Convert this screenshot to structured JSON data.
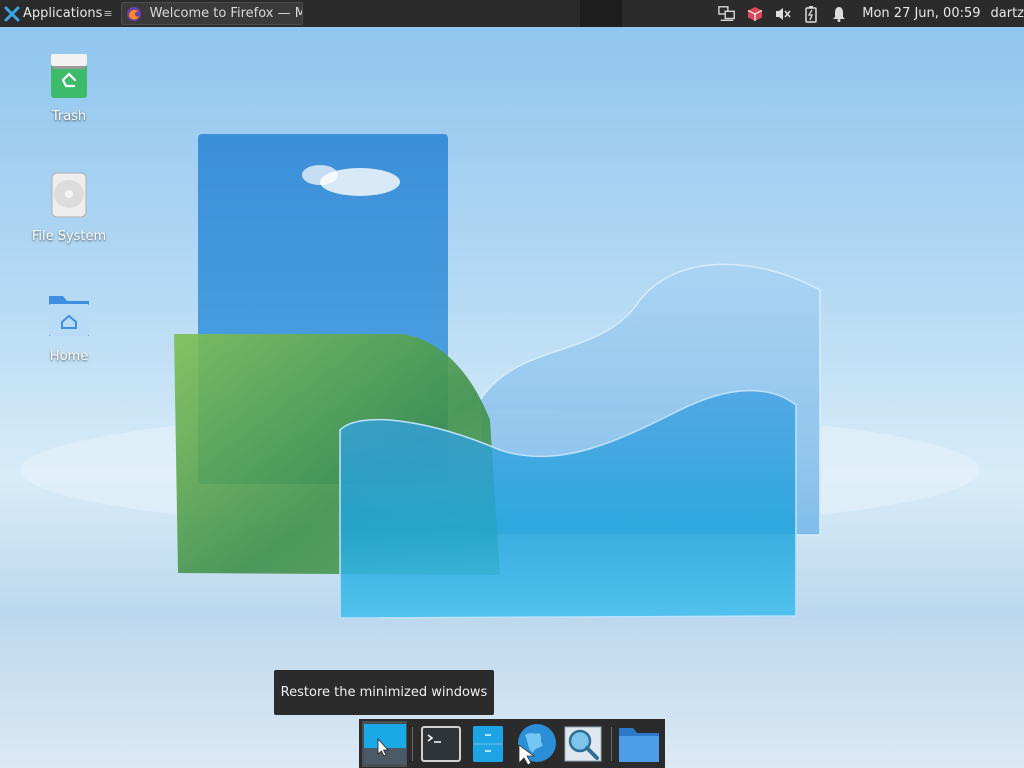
{
  "top_panel": {
    "applications_label": "Applications",
    "task_title": "Welcome to Firefox — Mo...",
    "clock": "Mon 27 Jun, 00:59",
    "user": "dartz",
    "tray_icons": [
      "network-icon",
      "package-updates-icon",
      "volume-muted-icon",
      "battery-charging-icon",
      "notifications-bell-icon"
    ]
  },
  "desktop": {
    "icons": [
      {
        "label": "Trash",
        "icon": "trash-icon"
      },
      {
        "label": "File System",
        "icon": "drive-icon"
      },
      {
        "label": "Home",
        "icon": "home-folder-icon"
      }
    ]
  },
  "tooltip": {
    "text": "Restore the minimized windows"
  },
  "dock": {
    "items": [
      {
        "name": "show-desktop",
        "icon": "show-desktop-icon",
        "active": true
      },
      {
        "name": "terminal",
        "icon": "terminal-icon"
      },
      {
        "name": "file-manager",
        "icon": "file-manager-icon"
      },
      {
        "name": "web-browser",
        "icon": "globe-browser-icon"
      },
      {
        "name": "app-finder",
        "icon": "magnifier-icon"
      },
      {
        "name": "home-folder",
        "icon": "folder-icon"
      }
    ]
  },
  "colors": {
    "panel": "#2b2b2b",
    "accent": "#2ea6e0",
    "folder": "#4d9ee6"
  }
}
